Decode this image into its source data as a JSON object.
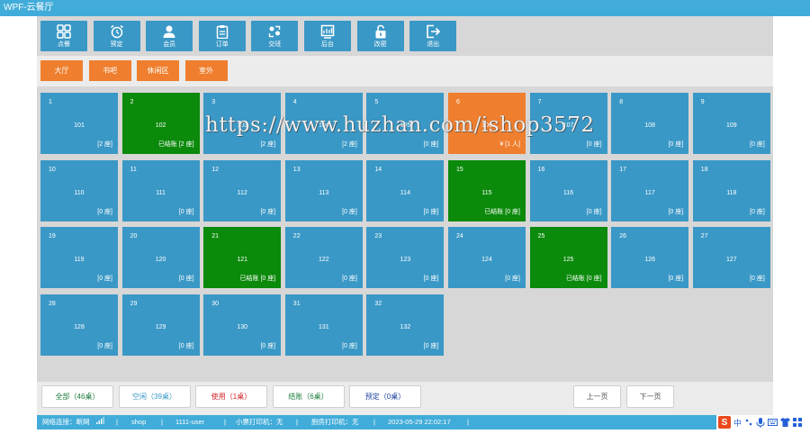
{
  "window": {
    "title": "WPF-云餐厅"
  },
  "toolbar": [
    {
      "label": "点餐",
      "icon": "grid-icon"
    },
    {
      "label": "预定",
      "icon": "alarm-clock-icon"
    },
    {
      "label": "会员",
      "icon": "user-icon"
    },
    {
      "label": "订单",
      "icon": "clipboard-icon"
    },
    {
      "label": "交班",
      "icon": "handover-icon"
    },
    {
      "label": "后台",
      "icon": "dashboard-icon"
    },
    {
      "label": "改密",
      "icon": "lock-icon"
    },
    {
      "label": "退出",
      "icon": "logout-icon"
    }
  ],
  "areas": [
    "大厅",
    "书吧",
    "休闲区",
    "室外"
  ],
  "colors": {
    "free": "#3a98c6",
    "checkout": "#0b8a0b",
    "in_use": "#ef7f2e",
    "bar": "#41acd9"
  },
  "tables": [
    {
      "num": "1",
      "name": "101",
      "status": "[2 座]",
      "state": "free"
    },
    {
      "num": "2",
      "name": "102",
      "status": "已结账 [2 座]",
      "state": "checkout"
    },
    {
      "num": "3",
      "name": "103",
      "status": "[2 座]",
      "state": "free"
    },
    {
      "num": "4",
      "name": "104",
      "status": "[2 座]",
      "state": "free"
    },
    {
      "num": "5",
      "name": "105",
      "status": "[0 座]",
      "state": "free"
    },
    {
      "num": "6",
      "name": "106",
      "status": "¥ [1 人]",
      "state": "in_use"
    },
    {
      "num": "7",
      "name": "107",
      "status": "[0 座]",
      "state": "free"
    },
    {
      "num": "8",
      "name": "108",
      "status": "[0 座]",
      "state": "free"
    },
    {
      "num": "9",
      "name": "109",
      "status": "[0 座]",
      "state": "free"
    },
    {
      "num": "10",
      "name": "110",
      "status": "[0 座]",
      "state": "free"
    },
    {
      "num": "11",
      "name": "111",
      "status": "[0 座]",
      "state": "free"
    },
    {
      "num": "12",
      "name": "112",
      "status": "[0 座]",
      "state": "free"
    },
    {
      "num": "13",
      "name": "113",
      "status": "[0 座]",
      "state": "free"
    },
    {
      "num": "14",
      "name": "114",
      "status": "[0 座]",
      "state": "free"
    },
    {
      "num": "15",
      "name": "115",
      "status": "已结账 [0 座]",
      "state": "checkout"
    },
    {
      "num": "16",
      "name": "116",
      "status": "[0 座]",
      "state": "free"
    },
    {
      "num": "17",
      "name": "117",
      "status": "[0 座]",
      "state": "free"
    },
    {
      "num": "18",
      "name": "118",
      "status": "[0 座]",
      "state": "free"
    },
    {
      "num": "19",
      "name": "119",
      "status": "[0 座]",
      "state": "free"
    },
    {
      "num": "20",
      "name": "120",
      "status": "[0 座]",
      "state": "free"
    },
    {
      "num": "21",
      "name": "121",
      "status": "已结账 [0 座]",
      "state": "checkout"
    },
    {
      "num": "22",
      "name": "122",
      "status": "[0 座]",
      "state": "free"
    },
    {
      "num": "23",
      "name": "123",
      "status": "[0 座]",
      "state": "free"
    },
    {
      "num": "24",
      "name": "124",
      "status": "[0 座]",
      "state": "free"
    },
    {
      "num": "25",
      "name": "125",
      "status": "已结账 [0 座]",
      "state": "checkout"
    },
    {
      "num": "26",
      "name": "126",
      "status": "[0 座]",
      "state": "free"
    },
    {
      "num": "27",
      "name": "127",
      "status": "[0 座]",
      "state": "free"
    },
    {
      "num": "28",
      "name": "128",
      "status": "[0 座]",
      "state": "free"
    },
    {
      "num": "29",
      "name": "129",
      "status": "[0 座]",
      "state": "free"
    },
    {
      "num": "30",
      "name": "130",
      "status": "[0 座]",
      "state": "free"
    },
    {
      "num": "31",
      "name": "131",
      "status": "[0 座]",
      "state": "free"
    },
    {
      "num": "32",
      "name": "132",
      "status": "[0 座]",
      "state": "free"
    }
  ],
  "filters": [
    {
      "label": "全部（46桌）",
      "color": "#1a7a3a"
    },
    {
      "label": "空闲（39桌）",
      "color": "#3a98c6"
    },
    {
      "label": "使用（1桌）",
      "color": "#d0272c"
    },
    {
      "label": "结账（6桌）",
      "color": "#1a7a3a"
    },
    {
      "label": "预定（0桌）",
      "color": "#1a3f9a"
    }
  ],
  "pager": {
    "prev": "上一页",
    "next": "下一页"
  },
  "status": {
    "network": "网络连接：断网",
    "shop": "shop",
    "user": "1111-user",
    "printer_small": "小票打印机：无",
    "printer_kitchen": "厨房打印机：无",
    "datetime": "2023-05-29 22:02:17",
    "sep": "|"
  },
  "ime": {
    "logo": "S",
    "lang": "中",
    "icons": [
      "punctuation-icon",
      "microphone-icon",
      "keyboard-icon",
      "shirt-icon",
      "grid-icon"
    ]
  },
  "watermark": "https://www.huzhan.com/ishop3572"
}
